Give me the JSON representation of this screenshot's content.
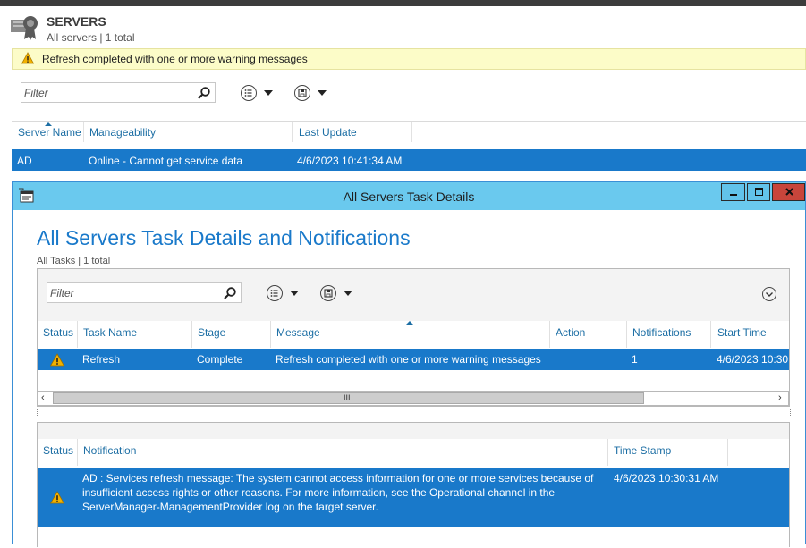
{
  "servers_header": {
    "title": "SERVERS",
    "subtitle": "All servers | 1 total"
  },
  "warning_bar": {
    "message": "Refresh completed with one or more warning messages"
  },
  "servers_filter": {
    "placeholder": "Filter"
  },
  "servers_grid": {
    "columns": [
      "Server Name",
      "Manageability",
      "Last Update"
    ],
    "rows": [
      {
        "server_name": "AD",
        "manageability": "Online - Cannot get service data",
        "last_update": "4/6/2023 10:41:34 AM"
      }
    ]
  },
  "dialog": {
    "title": "All Servers Task Details",
    "heading": "All Servers Task Details and Notifications",
    "subtitle": "All Tasks | 1 total",
    "filter_placeholder": "Filter",
    "tasks_grid": {
      "columns": [
        "Status",
        "Task Name",
        "Stage",
        "Message",
        "Action",
        "Notifications",
        "Start Time"
      ],
      "rows": [
        {
          "status": "warning",
          "task_name": "Refresh",
          "stage": "Complete",
          "message": "Refresh completed with one or more warning messages",
          "action": "",
          "notifications": "1",
          "start_time": "4/6/2023 10:30"
        }
      ]
    },
    "scrollbar_grip": "III",
    "notifications_grid": {
      "columns": [
        "Status",
        "Notification",
        "Time Stamp"
      ],
      "rows": [
        {
          "status": "warning",
          "notification_line1": "AD : Services refresh message: The system cannot access information for one or more services because of",
          "notification_line2": "insufficient access rights or other reasons. For more information, see the Operational channel in the",
          "notification_line3": "ServerManager-ManagementProvider log on the target server.",
          "time_stamp": "4/6/2023 10:30:31 AM"
        }
      ]
    }
  },
  "colors": {
    "accent": "#1979ca",
    "title_bar": "#6ac9ee",
    "warning_bg": "#fcfcc8",
    "close_button": "#c8453b"
  },
  "icons": [
    "server-role-icon",
    "warning-icon",
    "search-icon",
    "list-view-icon",
    "save-icon",
    "chevron-down-icon",
    "expand-circle-icon",
    "task-details-window-icon",
    "minimize-icon",
    "maximize-icon",
    "close-icon",
    "scroll-left-icon",
    "scroll-right-icon"
  ]
}
